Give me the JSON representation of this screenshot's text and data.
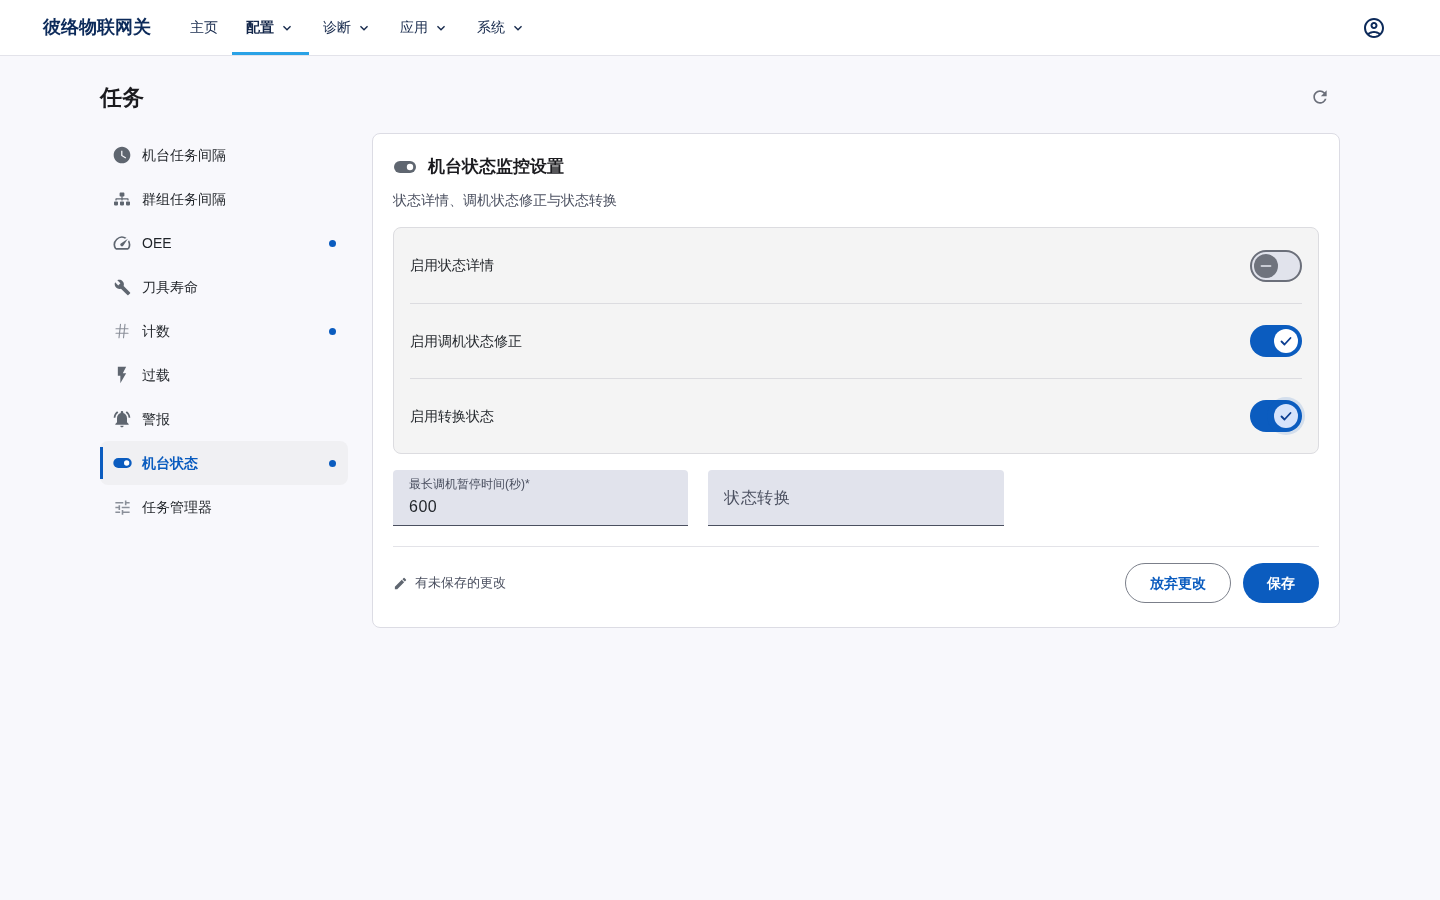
{
  "header": {
    "brand": "彼络物联网关",
    "nav": [
      {
        "label": "主页",
        "selected": false,
        "dropdown": false
      },
      {
        "label": "配置",
        "selected": true,
        "dropdown": true
      },
      {
        "label": "诊断",
        "selected": false,
        "dropdown": true
      },
      {
        "label": "应用",
        "selected": false,
        "dropdown": true
      },
      {
        "label": "系统",
        "selected": false,
        "dropdown": true
      }
    ]
  },
  "page": {
    "title": "任务"
  },
  "sidebar": {
    "items": [
      {
        "label": "机台任务间隔",
        "selected": false,
        "changed": false
      },
      {
        "label": "群组任务间隔",
        "selected": false,
        "changed": false
      },
      {
        "label": "OEE",
        "selected": false,
        "changed": true
      },
      {
        "label": "刀具寿命",
        "selected": false,
        "changed": false
      },
      {
        "label": "计数",
        "selected": false,
        "changed": true
      },
      {
        "label": "过载",
        "selected": false,
        "changed": false
      },
      {
        "label": "警报",
        "selected": false,
        "changed": false
      },
      {
        "label": "机台状态",
        "selected": true,
        "changed": true
      },
      {
        "label": "任务管理器",
        "selected": false,
        "changed": false
      }
    ]
  },
  "card": {
    "title": "机台状态监控设置",
    "subtitle": "状态详情、调机状态修正与状态转换",
    "switches": [
      {
        "label": "启用状态详情",
        "checked": false,
        "focused": false
      },
      {
        "label": "启用调机状态修正",
        "checked": true,
        "focused": false
      },
      {
        "label": "启用转换状态",
        "checked": true,
        "focused": true
      }
    ],
    "fields": [
      {
        "label": "最长调机暂停时间(秒)*",
        "value": "600"
      },
      {
        "placeholder": "状态转换"
      }
    ],
    "status": "有未保存的更改",
    "buttons": [
      {
        "label": "放弃更改",
        "kind": "outline"
      },
      {
        "label": "保存",
        "kind": "primary"
      }
    ]
  }
}
